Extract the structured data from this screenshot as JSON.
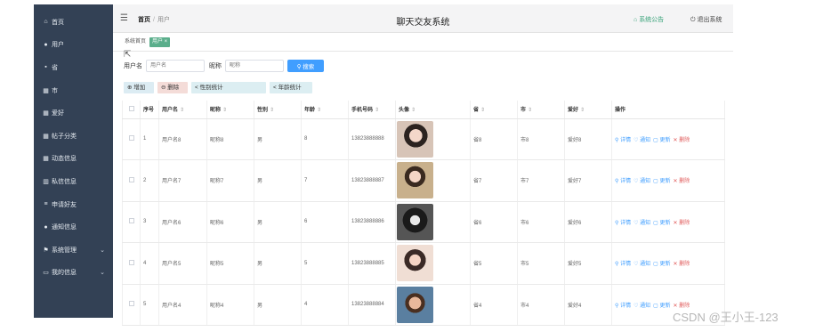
{
  "header": {
    "title": "聊天交友系统",
    "breadcrumb": [
      "首页",
      "用户"
    ],
    "notice": "系统公告",
    "exit": "退出系统"
  },
  "sidebar": {
    "items": [
      {
        "label": "首页",
        "icon": "home-icon",
        "glyph": "⌂"
      },
      {
        "label": "用户",
        "icon": "user-icon",
        "glyph": "●"
      },
      {
        "label": "省",
        "icon": "doc-icon",
        "glyph": "▪"
      },
      {
        "label": "市",
        "icon": "grid-icon",
        "glyph": "▦"
      },
      {
        "label": "爱好",
        "icon": "grid-icon",
        "glyph": "▦"
      },
      {
        "label": "帖子分类",
        "icon": "grid-icon",
        "glyph": "▦"
      },
      {
        "label": "动态信息",
        "icon": "grid-icon",
        "glyph": "▦"
      },
      {
        "label": "私信信息",
        "icon": "bar-chart-icon",
        "glyph": "▥"
      },
      {
        "label": "申请好友",
        "icon": "list-icon",
        "glyph": "≡"
      },
      {
        "label": "通知信息",
        "icon": "user-icon",
        "glyph": "●"
      },
      {
        "label": "系统管理",
        "icon": "flag-icon",
        "glyph": "⚑",
        "expandable": true
      },
      {
        "label": "我的信息",
        "icon": "card-icon",
        "glyph": "▭",
        "expandable": true
      }
    ]
  },
  "tags": {
    "home": "系统首页",
    "user": "用户 ×"
  },
  "search": {
    "username_label": "用户名",
    "username_placeholder": "用户名",
    "nickname_label": "昵称",
    "nickname_placeholder": "昵称",
    "button": "搜索"
  },
  "actions": {
    "add": "增加",
    "delete": "删除",
    "gender_stats": "性别统计",
    "age_stats": "年龄统计"
  },
  "table": {
    "columns": [
      "序号",
      "用户名",
      "昵称",
      "性别",
      "年龄",
      "手机号码",
      "头像",
      "省",
      "市",
      "爱好",
      "操作"
    ],
    "rows": [
      {
        "index": "1",
        "username": "用户名8",
        "nickname": "昵称8",
        "gender": "男",
        "age": "8",
        "phone": "13823888888",
        "province": "省8",
        "city": "市8",
        "hobby": "爱好8"
      },
      {
        "index": "2",
        "username": "用户名7",
        "nickname": "昵称7",
        "gender": "男",
        "age": "7",
        "phone": "13823888887",
        "province": "省7",
        "city": "市7",
        "hobby": "爱好7"
      },
      {
        "index": "3",
        "username": "用户名6",
        "nickname": "昵称6",
        "gender": "男",
        "age": "6",
        "phone": "13823888886",
        "province": "省6",
        "city": "市6",
        "hobby": "爱好6"
      },
      {
        "index": "4",
        "username": "用户名5",
        "nickname": "昵称5",
        "gender": "男",
        "age": "5",
        "phone": "13823888885",
        "province": "省5",
        "city": "市5",
        "hobby": "爱好5"
      },
      {
        "index": "5",
        "username": "用户名4",
        "nickname": "昵称4",
        "gender": "男",
        "age": "4",
        "phone": "13823888884",
        "province": "省4",
        "city": "市4",
        "hobby": "爱好4"
      }
    ],
    "ops": {
      "detail": "详情",
      "notify": "通知",
      "edit": "更新",
      "delete": "删除"
    }
  },
  "watermark": "CSDN @王小王-123",
  "colors": {
    "sidebar": "#334155",
    "primary": "#409eff",
    "tag_active": "#5aae8b",
    "danger": "#e05a5a"
  }
}
